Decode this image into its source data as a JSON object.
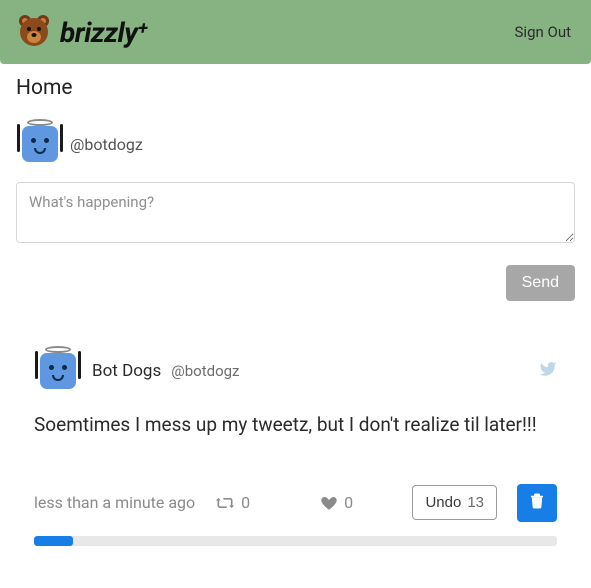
{
  "header": {
    "brand": "brizzly",
    "brand_suffix": "+",
    "signout": "Sign Out"
  },
  "page_title": "Home",
  "compose": {
    "handle": "@botdogz",
    "placeholder": "What's happening?",
    "value": "",
    "send_label": "Send"
  },
  "tweet": {
    "display_name": "Bot Dogs",
    "handle": "@botdogz",
    "body": "Soemtimes I mess up my tweetz, but I don't realize til later!!!",
    "timestamp": "less than a minute ago",
    "retweets": "0",
    "likes": "0",
    "undo_label": "Undo",
    "undo_seconds": "13",
    "progress_percent": 7.5
  },
  "colors": {
    "header_bg": "#87b282",
    "primary_blue": "#167ee6",
    "avatar_blue": "#5f97e0"
  }
}
